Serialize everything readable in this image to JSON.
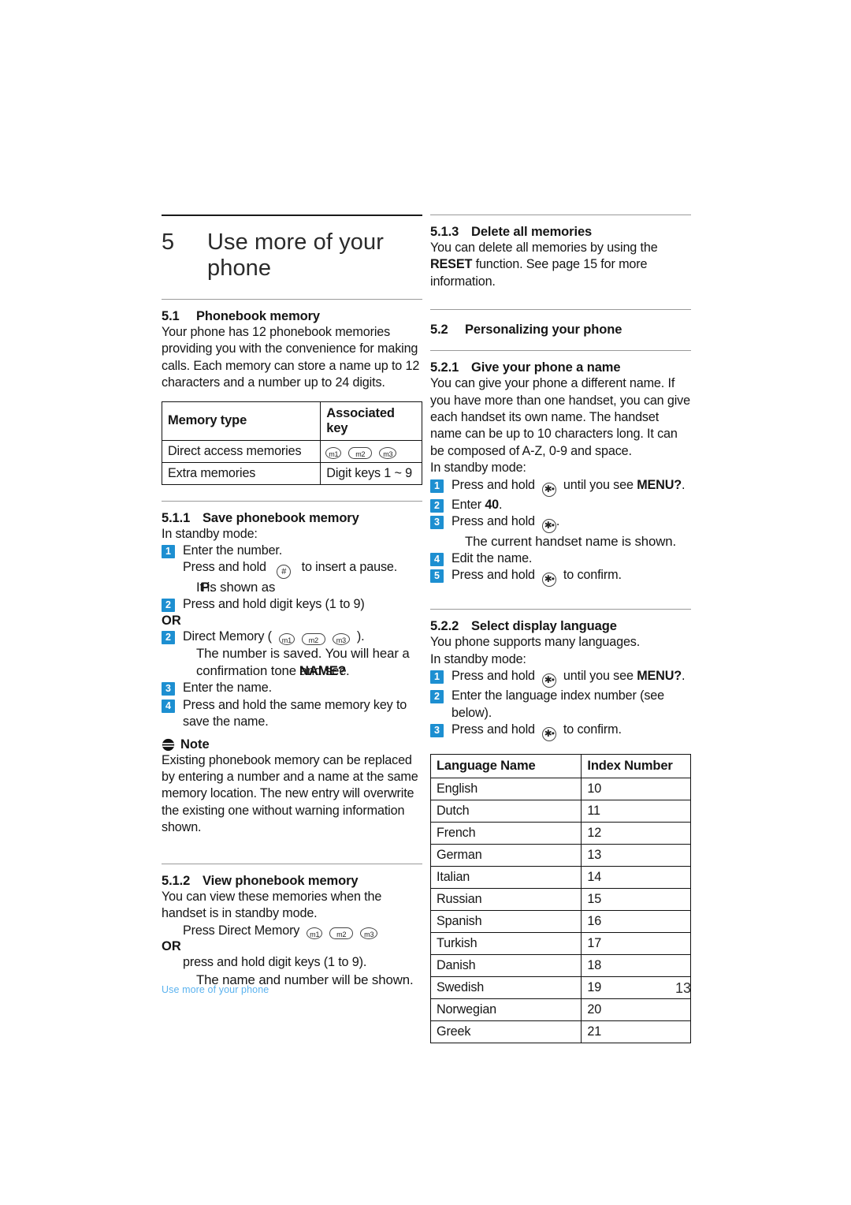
{
  "document": {
    "chapter_number": "5",
    "chapter_title": "Use more of your phone",
    "page_number": "13",
    "footer_label": "Use more of your phone"
  },
  "left_column": {
    "s51": {
      "number": "5.1",
      "title": "Phonebook memory",
      "body": "Your phone has 12 phonebook memories providing you with the convenience for making calls. Each memory can store a name up to 12 characters and a number up to 24 digits."
    },
    "memory_table": {
      "headers": [
        "Memory type",
        "Associated key"
      ],
      "rows": [
        {
          "type": "Direct access memories",
          "keys": [
            "m1",
            "m2",
            "m3"
          ],
          "key_text": ""
        },
        {
          "type": "Extra memories",
          "keys": [],
          "key_text": "Digit keys 1 ~ 9"
        }
      ]
    },
    "s511": {
      "number": "5.1.1",
      "title": "Save phonebook memory",
      "intro": "In standby mode:",
      "step1": "Enter the number.",
      "step1_sub_a": "Press and hold",
      "step1_sub_b": "to insert a pause.",
      "step1_sub_c": "It is shown as",
      "step1_sub_c_bold": "P",
      "step1_sub_c_end": ".",
      "step2": "Press and hold digit keys (1 to 9)",
      "or": "OR",
      "step2b_pre": "Direct Memory (",
      "step2b_post": ").",
      "step2b_result1": "The number is saved. You will hear a",
      "step2b_result2_a": "confirmation tone and see",
      "step2b_result2_bold": "NAME?",
      "step2b_result2_end": ".",
      "step3": "Enter the name.",
      "step4": "Press and hold the same memory key to save the name.",
      "badges": [
        "1",
        "2",
        "2",
        "3",
        "4"
      ]
    },
    "note": {
      "label": "Note",
      "body": "Existing phonebook memory can be replaced by entering a number and a name at the same memory location. The new entry will overwrite the existing one without warning information shown."
    },
    "s512": {
      "number": "5.1.2",
      "title": "View phonebook memory",
      "body": "You can view these memories when the handset is in standby mode.",
      "line_press": "Press Direct Memory",
      "or": "OR",
      "line_hold": "press and hold digit keys (1 to 9).",
      "line_result": "The name and number will be shown."
    }
  },
  "right_column": {
    "s513": {
      "number": "5.1.3",
      "title": "Delete all memories",
      "body_a": "You can delete all memories by using the",
      "body_bold": "RESET",
      "body_b": "function. See page 15 for more information."
    },
    "s52": {
      "number": "5.2",
      "title": "Personalizing your phone"
    },
    "s521": {
      "number": "5.2.1",
      "title": "Give your phone a name",
      "body": "You can give your phone a different name. If you have more than one handset, you can give each handset its own name. The handset name can be up to 10 characters long. It can be composed of A-Z, 0-9 and space.",
      "intro": "In standby mode:",
      "step1_a": "Press and hold",
      "step1_b": "until you see",
      "step1_bold": "MENU?",
      "step1_end": ".",
      "step2_a": "Enter",
      "step2_bold": "40",
      "step2_end": ".",
      "step3_a": "Press and hold",
      "step3_end": ".",
      "step3_result": "The current handset name is shown.",
      "step4": "Edit the name.",
      "step5_a": "Press and hold",
      "step5_b": "to confirm.",
      "badges": [
        "1",
        "2",
        "3",
        "4",
        "5"
      ]
    },
    "s522": {
      "number": "5.2.2",
      "title": "Select display language",
      "body": "You phone supports many languages.",
      "intro": "In standby mode:",
      "step1_a": "Press and hold",
      "step1_b": "until you see",
      "step1_bold": "MENU?",
      "step1_end": ".",
      "step2": "Enter the language index number (see below).",
      "step3_a": "Press and hold",
      "step3_b": "to confirm.",
      "badges": [
        "1",
        "2",
        "3"
      ]
    },
    "language_table": {
      "headers": [
        "Language Name",
        "Index Number"
      ],
      "rows": [
        {
          "name": "English",
          "index": "10"
        },
        {
          "name": "Dutch",
          "index": "11"
        },
        {
          "name": "French",
          "index": "12"
        },
        {
          "name": "German",
          "index": "13"
        },
        {
          "name": "Italian",
          "index": "14"
        },
        {
          "name": "Russian",
          "index": "15"
        },
        {
          "name": "Spanish",
          "index": "16"
        },
        {
          "name": "Turkish",
          "index": "17"
        },
        {
          "name": "Danish",
          "index": "18"
        },
        {
          "name": "Swedish",
          "index": "19"
        },
        {
          "name": "Norwegian",
          "index": "20"
        },
        {
          "name": "Greek",
          "index": "21"
        }
      ]
    }
  },
  "icons": {
    "m1": "m1",
    "m2": "m2",
    "m3": "m3",
    "hash": "#",
    "star": "✱•"
  },
  "colors": {
    "badge_blue": "#1d8fd1",
    "footer_blue": "#5cb3ef",
    "rule_dark": "#1a1a1a",
    "rule_light": "#9a9a9a"
  }
}
